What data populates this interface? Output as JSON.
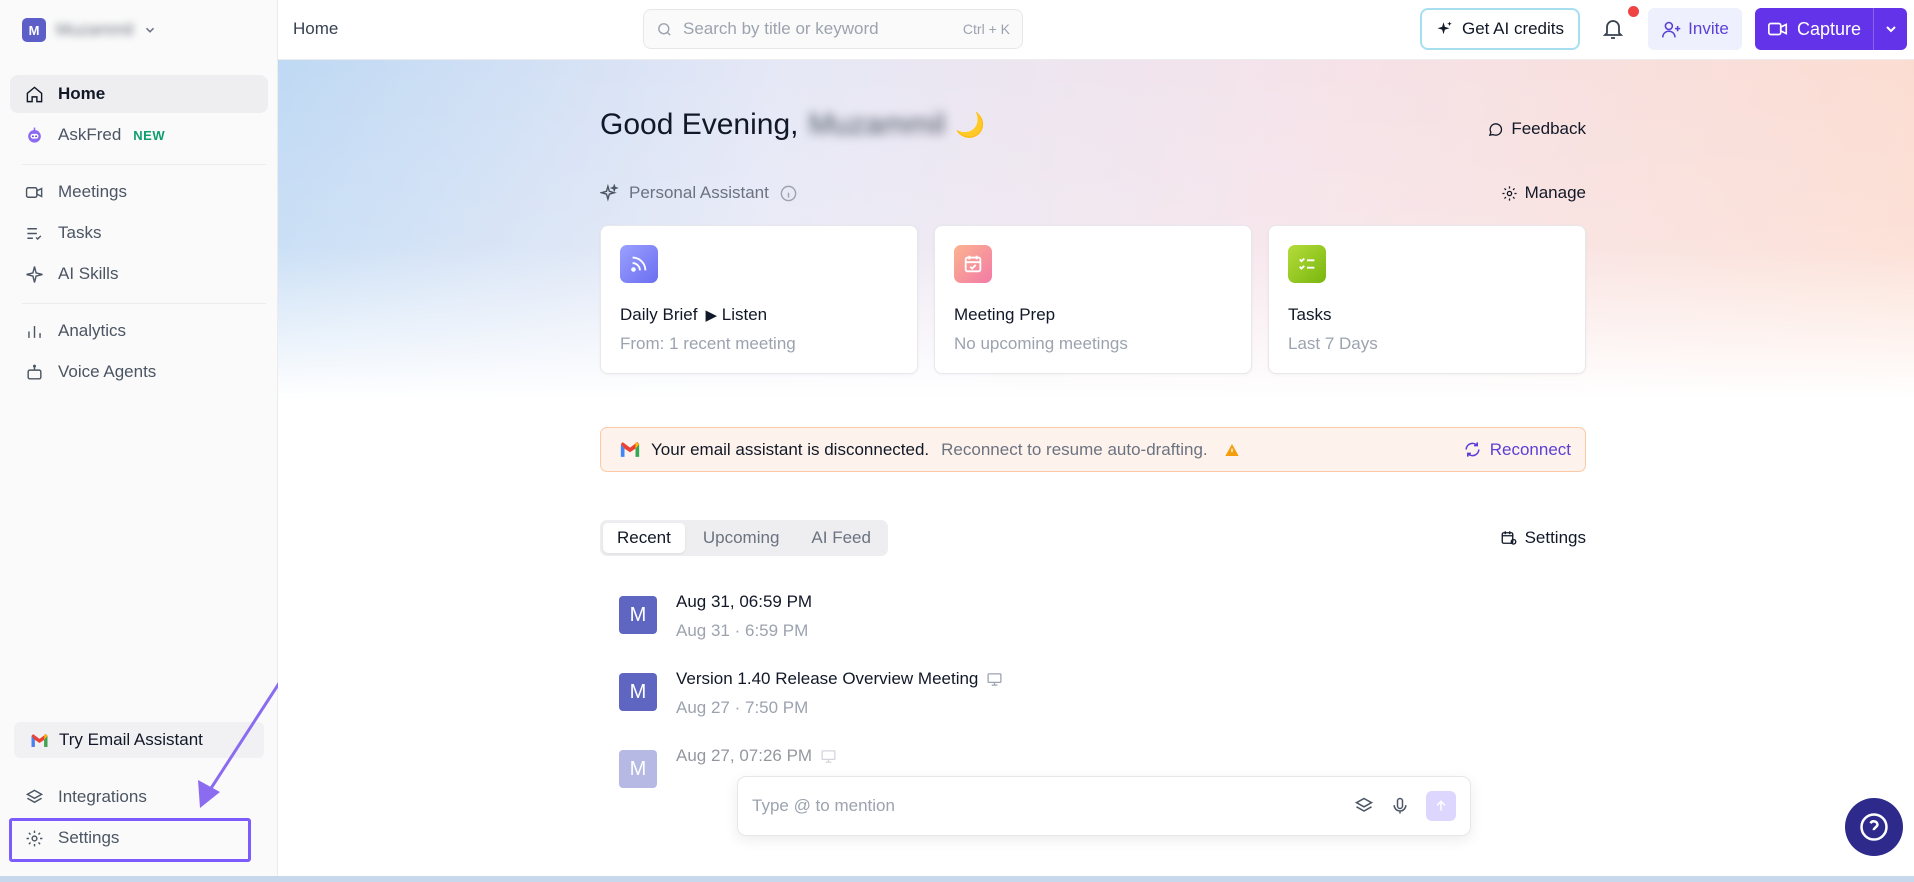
{
  "sidebar": {
    "workspace": {
      "avatar_letter": "M",
      "name": "Muzammil"
    },
    "items": [
      {
        "label": "Home",
        "icon": "home-icon",
        "active": true
      },
      {
        "label": "AskFred",
        "icon": "bot-icon",
        "badge": "NEW"
      },
      {
        "label": "Meetings",
        "icon": "video-icon"
      },
      {
        "label": "Tasks",
        "icon": "tasks-icon"
      },
      {
        "label": "AI Skills",
        "icon": "sparkle-icon"
      },
      {
        "label": "Analytics",
        "icon": "bar-chart-icon"
      },
      {
        "label": "Voice Agents",
        "icon": "robot-icon"
      }
    ],
    "try_email": "Try Email Assistant",
    "integrations": "Integrations",
    "settings": "Settings"
  },
  "topbar": {
    "breadcrumb": "Home",
    "search_placeholder": "Search by title or keyword",
    "search_shortcut": "Ctrl + K",
    "credits_label": "Get AI credits",
    "invite_label": "Invite",
    "capture_label": "Capture"
  },
  "home": {
    "greeting": "Good Evening,",
    "user_name": "Muzammil",
    "greeting_emoji": "🌙",
    "feedback": "Feedback",
    "assistant_label": "Personal Assistant",
    "manage": "Manage",
    "cards": [
      {
        "title": "Daily Brief",
        "action": "Listen",
        "subtitle": "From: 1 recent meeting",
        "color": "#7b7ff2"
      },
      {
        "title": "Meeting Prep",
        "subtitle": "No upcoming meetings",
        "color": "#f68ba1"
      },
      {
        "title": "Tasks",
        "subtitle": "Last 7 Days",
        "color": "#8cc21f"
      }
    ],
    "banner": {
      "bold": "Your email assistant is disconnected.",
      "text": "Reconnect to resume auto-drafting.",
      "action": "Reconnect"
    },
    "tabs": [
      "Recent",
      "Upcoming",
      "AI Feed"
    ],
    "list_settings": "Settings",
    "meetings": [
      {
        "avatar": "M",
        "title": "Aug 31, 06:59 PM",
        "subtitle": "Aug 31 · 6:59 PM"
      },
      {
        "avatar": "M",
        "title": "Version 1.40 Release Overview Meeting",
        "subtitle": "Aug 27 · 7:50 PM"
      },
      {
        "avatar": "M",
        "title": "Aug 27, 07:26 PM",
        "subtitle": ""
      }
    ],
    "composer_placeholder": "Type @ to mention"
  },
  "colors": {
    "accent": "#6233e8",
    "accent_light": "#eef0fd",
    "banner_bg": "#fef3ec",
    "help_bg": "#2d2a8c"
  }
}
